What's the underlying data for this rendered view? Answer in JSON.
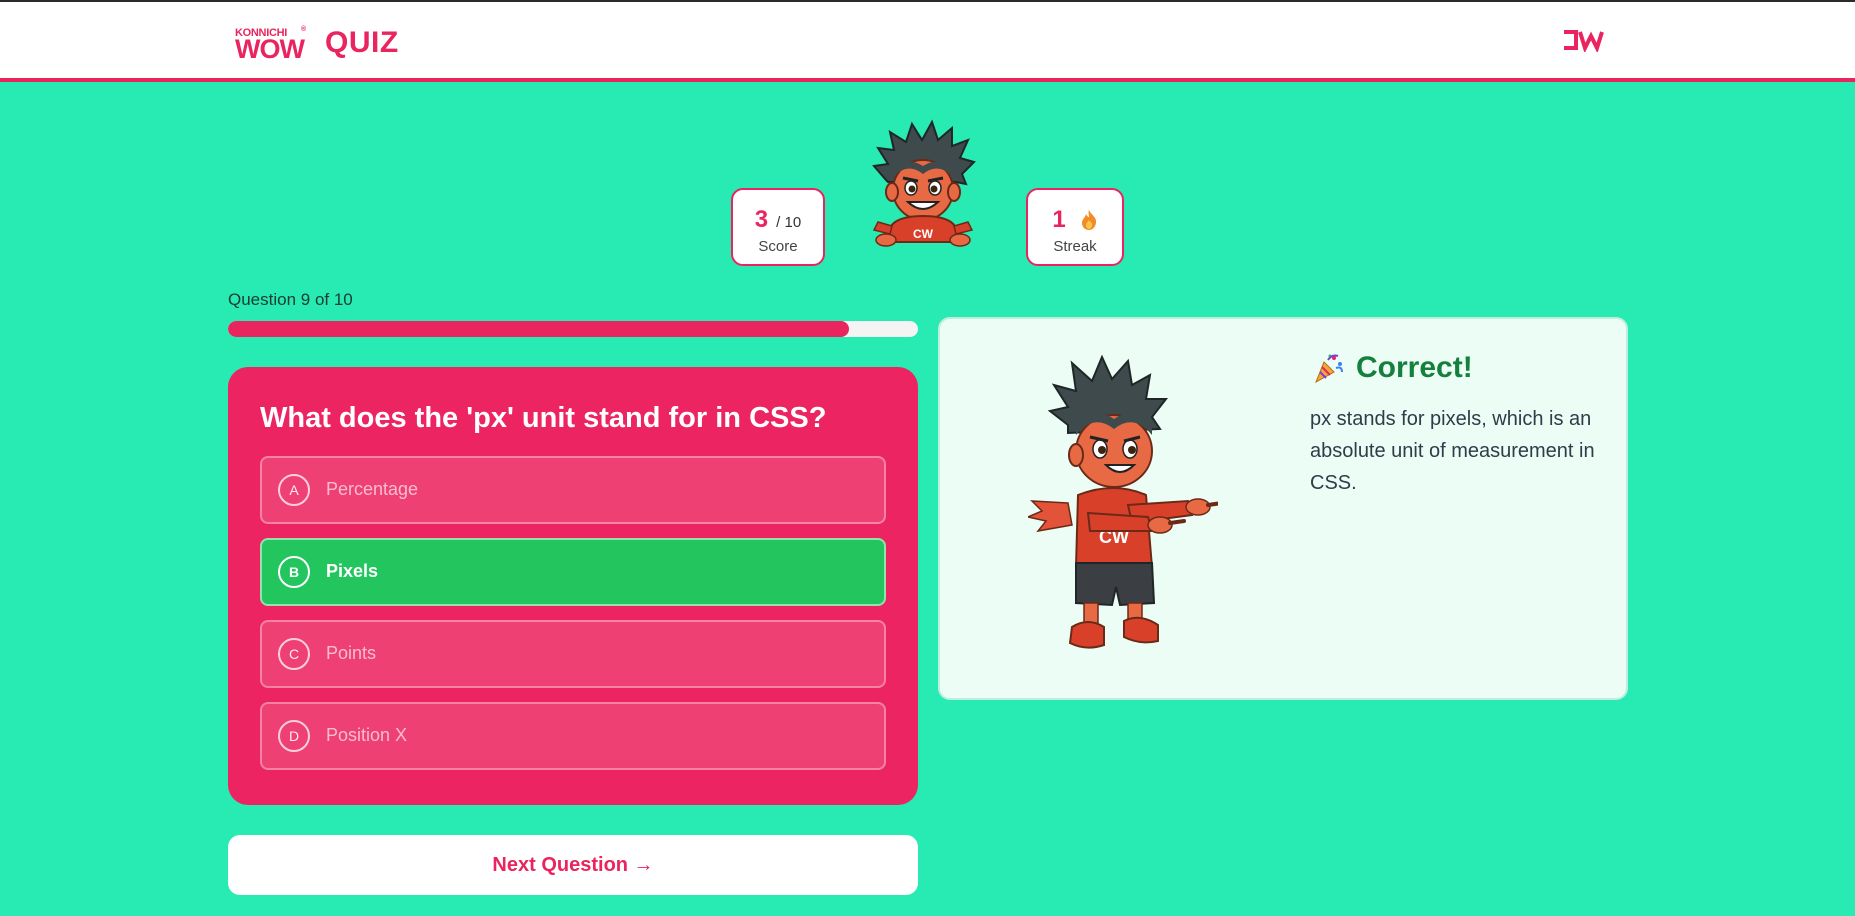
{
  "header": {
    "logo_small": "KONNICHI",
    "logo_big": "WOW",
    "logo_tm": "®",
    "title": "QUIZ"
  },
  "stats": {
    "score_value": "3",
    "score_total": "/ 10",
    "score_label": "Score",
    "streak_value": "1",
    "streak_label": "Streak"
  },
  "progress": {
    "label": "Question 9 of 10",
    "fraction": 0.9
  },
  "question": {
    "text": "What does the 'px' unit stand for in CSS?",
    "options": [
      {
        "letter": "A",
        "label": "Percentage"
      },
      {
        "letter": "B",
        "label": "Pixels"
      },
      {
        "letter": "C",
        "label": "Points"
      },
      {
        "letter": "D",
        "label": "Position X"
      }
    ],
    "selected_correct": "B"
  },
  "next_button": "Next Question →",
  "feedback": {
    "title": "Correct!",
    "text": "px stands for pixels, which is an absolute unit of measurement in CSS."
  },
  "colors": {
    "background": "#27EBB2",
    "accent": "#E9245F",
    "correct": "#22C55E",
    "feedback_title": "#15803D"
  },
  "icons": {
    "brand_mark": "cw-logo-icon",
    "streak": "flame-icon",
    "feedback": "party-popper-icon"
  }
}
